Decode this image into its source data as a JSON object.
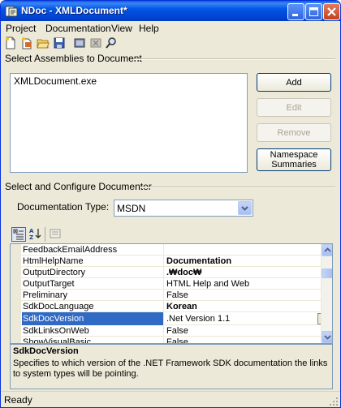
{
  "window": {
    "title": "NDoc - XMLDocument*",
    "caption_buttons": [
      "minimize-icon",
      "maximize-icon",
      "close-icon"
    ]
  },
  "menu": [
    {
      "label": "Project"
    },
    {
      "label": "Documentation"
    },
    {
      "label": "View"
    },
    {
      "label": "Help"
    }
  ],
  "toolbar": {
    "icons": [
      "new-file-icon",
      "new-from-solution-icon",
      "open-folder-icon",
      "save-icon",
      "build-icon",
      "cancel-build-icon",
      "view-docs-icon"
    ]
  },
  "assemblies": {
    "group_label": "Select Assemblies to Document",
    "items": [
      "XMLDocument.exe"
    ],
    "buttons": {
      "add": "Add",
      "edit": "Edit",
      "remove": "Remove",
      "namespace": "Namespace Summaries"
    }
  },
  "documenter": {
    "group_label": "Select and Configure Documenter",
    "type_label": "Documentation Type:",
    "type_value": "MSDN"
  },
  "property_grid": {
    "toolbar_icons": [
      "categorized-icon",
      "alphabetical-icon",
      "property-pages-icon"
    ],
    "rows": [
      {
        "name": "FeedbackEmailAddress",
        "value": ""
      },
      {
        "name": "HtmlHelpName",
        "value": "Documentation"
      },
      {
        "name": "OutputDirectory",
        "value": ".₩doc₩"
      },
      {
        "name": "OutputTarget",
        "value": "HTML Help and Web"
      },
      {
        "name": "Preliminary",
        "value": "False"
      },
      {
        "name": "SdkDocLanguage",
        "value": "Korean"
      },
      {
        "name": "SdkDocVersion",
        "value": ".Net Version 1.1"
      },
      {
        "name": "SdkLinksOnWeb",
        "value": "False"
      },
      {
        "name": "ShowVisualBasic",
        "value": "False"
      }
    ],
    "selected": "SdkDocVersion"
  },
  "description": {
    "title": "SdkDocVersion",
    "text": "Specifies to which version of the .NET Framework SDK documentation the links to system types will be pointing."
  },
  "status": {
    "text": "Ready"
  }
}
